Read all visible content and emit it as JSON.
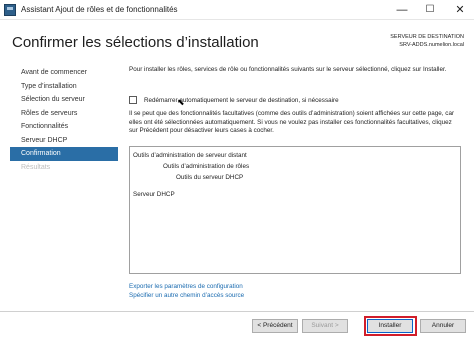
{
  "window": {
    "title": "Assistant Ajout de rôles et de fonctionnalités",
    "controls": {
      "minimize": "—",
      "maximize": "☐",
      "close": "✕"
    }
  },
  "header": {
    "title": "Confirmer les sélections d’installation",
    "server_label": "SERVEUR DE DESTINATION",
    "server_name": "SRV-ADDS.numelion.local"
  },
  "nav": {
    "items": [
      {
        "label": "Avant de commencer",
        "state": "normal"
      },
      {
        "label": "Type d’installation",
        "state": "normal"
      },
      {
        "label": "Sélection du serveur",
        "state": "normal"
      },
      {
        "label": "Rôles de serveurs",
        "state": "normal"
      },
      {
        "label": "Fonctionnalités",
        "state": "normal"
      },
      {
        "label": "Serveur DHCP",
        "state": "normal"
      },
      {
        "label": "Confirmation",
        "state": "active"
      },
      {
        "label": "Résultats",
        "state": "disabled"
      }
    ]
  },
  "content": {
    "intro": "Pour installer les rôles, services de rôle ou fonctionnalités suivants sur le serveur sélectionné, cliquez sur Installer.",
    "restart_checkbox_label": "Redémarrer automatiquement le serveur de destination, si nécessaire",
    "restart_checked": false,
    "optional_note": "Il se peut que des fonctionnalités facultatives (comme des outils d’administration) soient affichées sur cette page, car elles ont été sélectionnées automatiquement. Si vous ne voulez pas installer ces fonctionnalités facultatives, cliquez sur Précédent pour désactiver leurs cases à cocher."
  },
  "features": [
    "Outils d’administration de serveur distant",
    "Outils d’administration de rôles",
    "Outils du serveur DHCP",
    "Serveur DHCP"
  ],
  "links": {
    "export": "Exporter les paramètres de configuration",
    "alternate_source": "Spécifier un autre chemin d’accès source"
  },
  "buttons": {
    "previous": "< Précédent",
    "next": "Suivant >",
    "install": "Installer",
    "cancel": "Annuler"
  },
  "colors": {
    "nav_active": "#2a6ea6",
    "link": "#1a6bb0",
    "highlight": "#d11e2a"
  }
}
